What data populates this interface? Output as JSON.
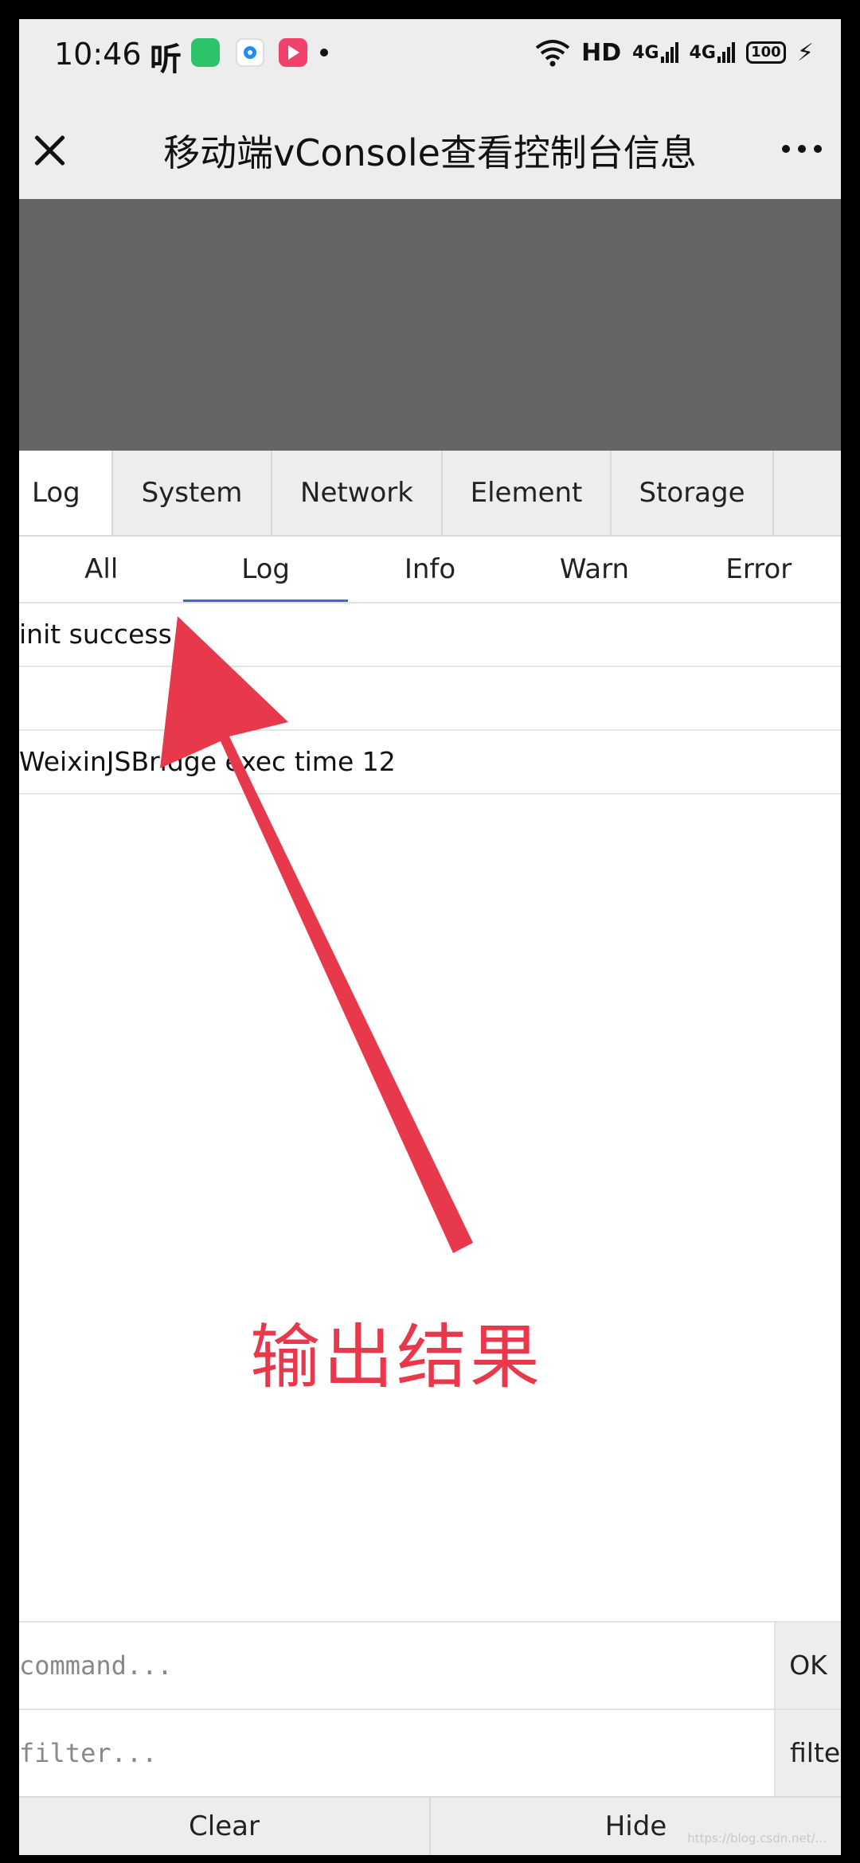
{
  "status_bar": {
    "time": "10:46",
    "ting_icon": "听",
    "hd": "HD",
    "net1": "4G",
    "net2": "4G",
    "battery": "100"
  },
  "nav": {
    "title": "移动端vConsole查看控制台信息"
  },
  "vconsole": {
    "tabs": [
      "Log",
      "System",
      "Network",
      "Element",
      "Storage"
    ],
    "subtabs": [
      "All",
      "Log",
      "Info",
      "Warn",
      "Error"
    ],
    "active_subtab": "Log",
    "logs": [
      "init success",
      "",
      "WeixinJSBridge exec time 12"
    ],
    "command_placeholder": "command...",
    "ok_label": "OK",
    "filter_placeholder": "filter...",
    "filter_label": "filter",
    "clear_label": "Clear",
    "hide_label": "Hide"
  },
  "annotation": {
    "text": "输出结果",
    "color": "#e8394c"
  },
  "watermark": "https://blog.csdn.net/..."
}
